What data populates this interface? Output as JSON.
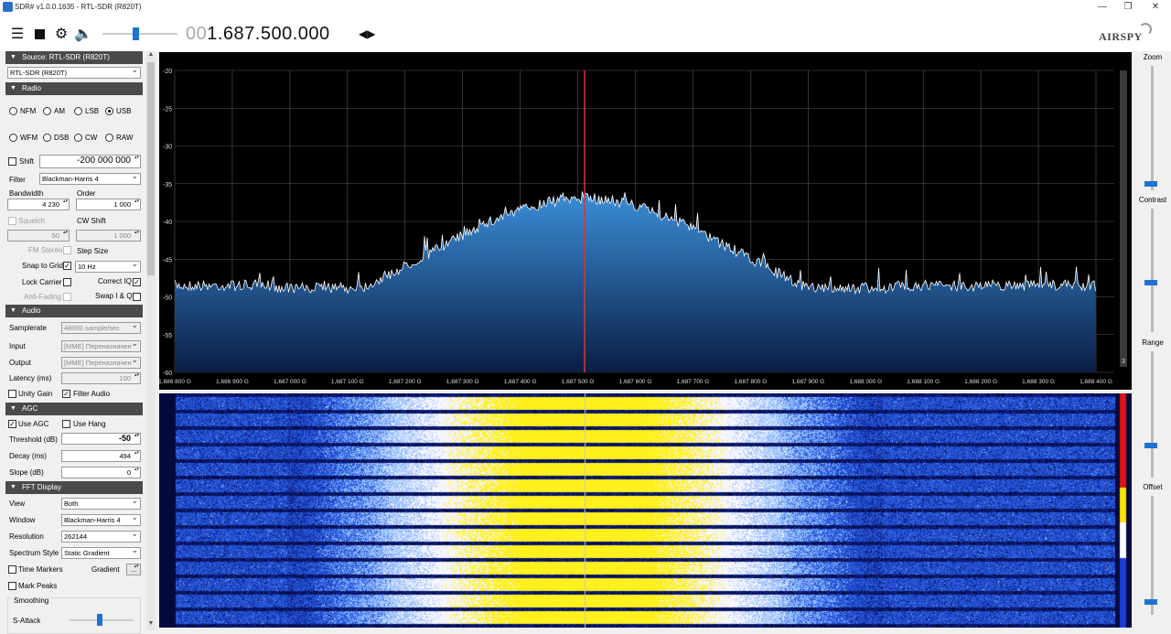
{
  "window": {
    "title": "SDR# v1.0.0.1635 - RTL-SDR (R820T)"
  },
  "toolbar": {
    "freq_prefix": "00",
    "freq_main": "1.687.500.000",
    "logo": "AIRSPY",
    "volume": 0.42
  },
  "source": {
    "header": "Source: RTL-SDR (R820T)",
    "device": "RTL-SDR (R820T)"
  },
  "radio": {
    "header": "Radio",
    "modes": [
      "NFM",
      "AM",
      "LSB",
      "USB",
      "WFM",
      "DSB",
      "CW",
      "RAW"
    ],
    "selected_mode": "USB",
    "shift_label": "Shift",
    "shift_value": "-200 000 000",
    "filter_label": "Filter",
    "filter_value": "Blackman-Harris 4",
    "bandwidth_label": "Bandwidth",
    "bandwidth_value": "4 230",
    "order_label": "Order",
    "order_value": "1 000",
    "squelch_label": "Squelch",
    "squelch_value": "50",
    "cw_shift_label": "CW Shift",
    "cw_shift_value": "1 000",
    "fm_stereo_label": "FM Stereo",
    "step_size_label": "Step Size",
    "snap_label": "Snap to Grid",
    "step_value": "10 Hz",
    "lock_carrier_label": "Lock Carrier",
    "correct_iq_label": "Correct IQ",
    "anti_fading_label": "Anti-Fading",
    "swap_iq_label": "Swap I & Q"
  },
  "audio": {
    "header": "Audio",
    "samplerate_label": "Samplerate",
    "samplerate_value": "48000 sample/sec",
    "input_label": "Input",
    "input_value": "[MME] Переназначен",
    "output_label": "Output",
    "output_value": "[MME] Переназначен",
    "latency_label": "Latency (ms)",
    "latency_value": "100",
    "unity_gain_label": "Unity Gain",
    "filter_audio_label": "Filter Audio"
  },
  "agc": {
    "header": "AGC",
    "use_agc_label": "Use AGC",
    "use_hang_label": "Use Hang",
    "threshold_label": "Threshold (dB)",
    "threshold_value": "-50",
    "decay_label": "Decay (ms)",
    "decay_value": "494",
    "slope_label": "Slope (dB)",
    "slope_value": "0"
  },
  "fft": {
    "header": "FFT Display",
    "view_label": "View",
    "view_value": "Both",
    "window_label": "Window",
    "window_value": "Blackman-Harris 4",
    "resolution_label": "Resolution",
    "resolution_value": "262144",
    "spectrum_style_label": "Spectrum Style",
    "spectrum_style_value": "Static Gradient",
    "time_markers_label": "Time Markers",
    "gradient_label": "Gradient",
    "gradient_btn": "...",
    "mark_peaks_label": "Mark Peaks",
    "smoothing_label": "Smoothing",
    "sattack_label": "S-Attack"
  },
  "right_panel": {
    "zoom_label": "Zoom",
    "contrast_label": "Contrast",
    "range_label": "Range",
    "offset_label": "Offset"
  },
  "spectrum": {
    "y_ticks": [
      "-20",
      "-25",
      "-30",
      "-35",
      "-40",
      "-45",
      "-50",
      "-55",
      "-60"
    ],
    "x_ticks": [
      "1,686 800 G",
      "1,686 900 G",
      "1,687 000 G",
      "1,687 100 G",
      "1,687 200 G",
      "1,687 300 G",
      "1,687 400 G",
      "1,687 500 G",
      "1,687 600 G",
      "1,687 700 G",
      "1,687 800 G",
      "1,687 900 G",
      "1,688 000 G",
      "1,688 100 G",
      "1,688 200 G",
      "1,688 300 G",
      "1,688 400 G"
    ],
    "scale_value": "3",
    "colors": {
      "fill_top": "#3b8fd8",
      "fill_bottom": "#0b1e45",
      "trace": "#ffffff",
      "carrier": "#d33",
      "grid": "#555"
    }
  }
}
